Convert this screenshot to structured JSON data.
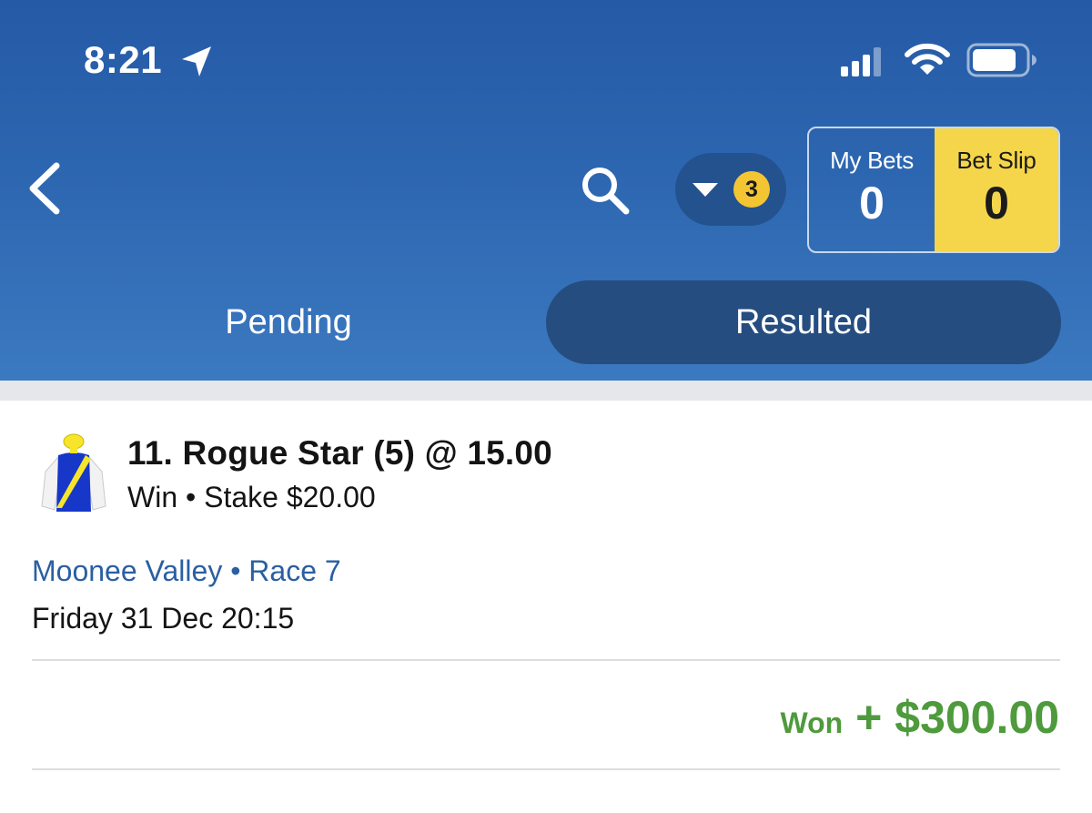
{
  "status_bar": {
    "time": "8:21",
    "icons": [
      "location-arrow-icon",
      "cellular-signal-icon",
      "wifi-icon",
      "battery-icon"
    ]
  },
  "header": {
    "filter_count": "3",
    "my_bets": {
      "label": "My Bets",
      "count": "0"
    },
    "bet_slip": {
      "label": "Bet Slip",
      "count": "0"
    }
  },
  "tabs": [
    {
      "label": "Pending",
      "active": false
    },
    {
      "label": "Resulted",
      "active": true
    }
  ],
  "bet": {
    "title": "11. Rogue Star (5) @ 15.00",
    "subtitle": "Win • Stake $20.00",
    "venue": "Moonee Valley • Race 7",
    "date": "Friday 31 Dec 20:15",
    "result_label": "Won",
    "result_amount": "+ $300.00"
  },
  "colors": {
    "header_blue": "#2d66b0",
    "active_tab": "#254d80",
    "bet_slip_yellow": "#f5d64a",
    "badge_yellow": "#f4c533",
    "link_blue": "#2a5fa2",
    "won_green": "#4e9a3c"
  }
}
